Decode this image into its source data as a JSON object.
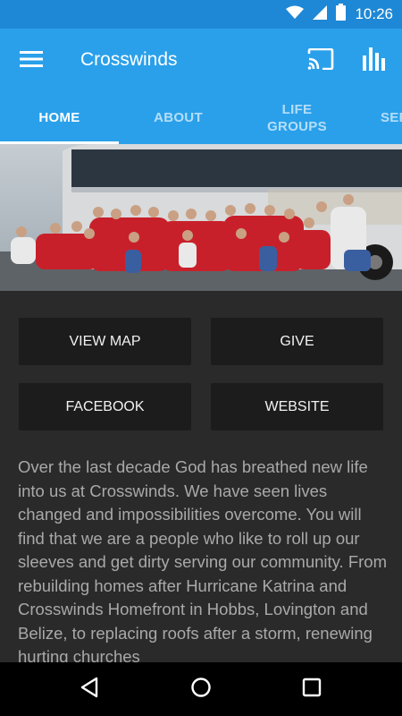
{
  "status_bar": {
    "time": "10:26",
    "icons": [
      "wifi-icon",
      "signal-icon",
      "battery-icon"
    ]
  },
  "app_bar": {
    "title": "Crosswinds",
    "icons": [
      "menu-icon",
      "cast-icon",
      "bar-chart-icon"
    ]
  },
  "tabs": [
    {
      "label": "HOME",
      "active": true
    },
    {
      "label": "ABOUT",
      "active": false
    },
    {
      "label": "LIFE\nGROUPS",
      "active": false
    },
    {
      "label": "SER",
      "active": false
    }
  ],
  "hero": {
    "icon": "group-photo-image"
  },
  "actions": {
    "view_map": "VIEW MAP",
    "give": "GIVE",
    "facebook": "FACEBOOK",
    "website": "WEBSITE"
  },
  "description": "Over the last decade God has breathed new life into us at Crosswinds. We have seen lives changed and impossibilities overcome. You will find that we are a people who like to roll up our sleeves and get dirty serving our community. From rebuilding homes after Hurricane Katrina and Crosswinds Homefront in Hobbs, Lovington and Belize, to replacing roofs after a storm, renewing hurting churches",
  "nav_bar": {
    "icons": [
      "back-icon",
      "home-icon",
      "recents-icon"
    ]
  },
  "colors": {
    "status_bar": "#1e88d6",
    "app_bar": "#2aa0ea",
    "background": "#2a2a2a",
    "button": "#1c1c1c",
    "text": "#a9a9a9"
  }
}
